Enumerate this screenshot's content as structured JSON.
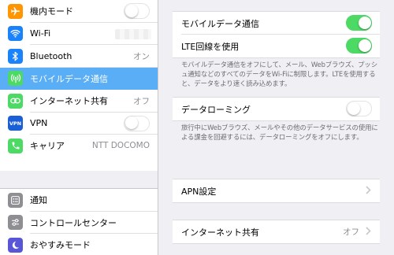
{
  "sidebar": {
    "items": [
      {
        "label": "機内モード",
        "icon": "airplane-icon",
        "icon_color": "#ff9500",
        "toggle": false
      },
      {
        "label": "Wi-Fi",
        "icon": "wifi-icon",
        "icon_color": "#1a82fb"
      },
      {
        "label": "Bluetooth",
        "icon": "bluetooth-icon",
        "icon_color": "#1a82fb",
        "value": "オン"
      },
      {
        "label": "モバイルデータ通信",
        "icon": "cellular-icon",
        "icon_color": "#4cd964",
        "selected": true
      },
      {
        "label": "インターネット共有",
        "icon": "personal-hotspot-icon",
        "icon_color": "#4cd964",
        "value": "オフ"
      },
      {
        "label": "VPN",
        "icon": "vpn-icon",
        "icon_color": "#1a5fd8",
        "icon_text": "VPN",
        "toggle": false
      },
      {
        "label": "キャリア",
        "icon": "phone-icon",
        "icon_color": "#4cd964",
        "value": "NTT DOCOMO"
      }
    ],
    "items2": [
      {
        "label": "通知",
        "icon": "notifications-icon",
        "icon_color": "#8e8e93"
      },
      {
        "label": "コントロールセンター",
        "icon": "control-center-icon",
        "icon_color": "#8e8e93"
      },
      {
        "label": "おやすみモード",
        "icon": "do-not-disturb-icon",
        "icon_color": "#5856d6"
      }
    ]
  },
  "detail": {
    "cellular_data_label": "モバイルデータ通信",
    "cellular_data_on": true,
    "lte_label": "LTE回線を使用",
    "lte_on": true,
    "footnote1": "モバイルデータ通信をオフにして、メール、Webブラウズ、プッシュ通知などのすべてのデータをWi-Fiに制限します。LTEを使用すると、データをより速く読み込めます。",
    "roaming_label": "データローミング",
    "roaming_on": false,
    "footnote2": "旅行中にWebブラウズ、メールやその他のデータサービスの使用による課金を回避するには、データローミングをオフにします。",
    "apn_label": "APN設定",
    "hotspot_label": "インターネット共有",
    "hotspot_value": "オフ"
  },
  "colors": {
    "accent": "#5aaef5",
    "toggle_on": "#4cd964",
    "background": "#efeff4"
  }
}
